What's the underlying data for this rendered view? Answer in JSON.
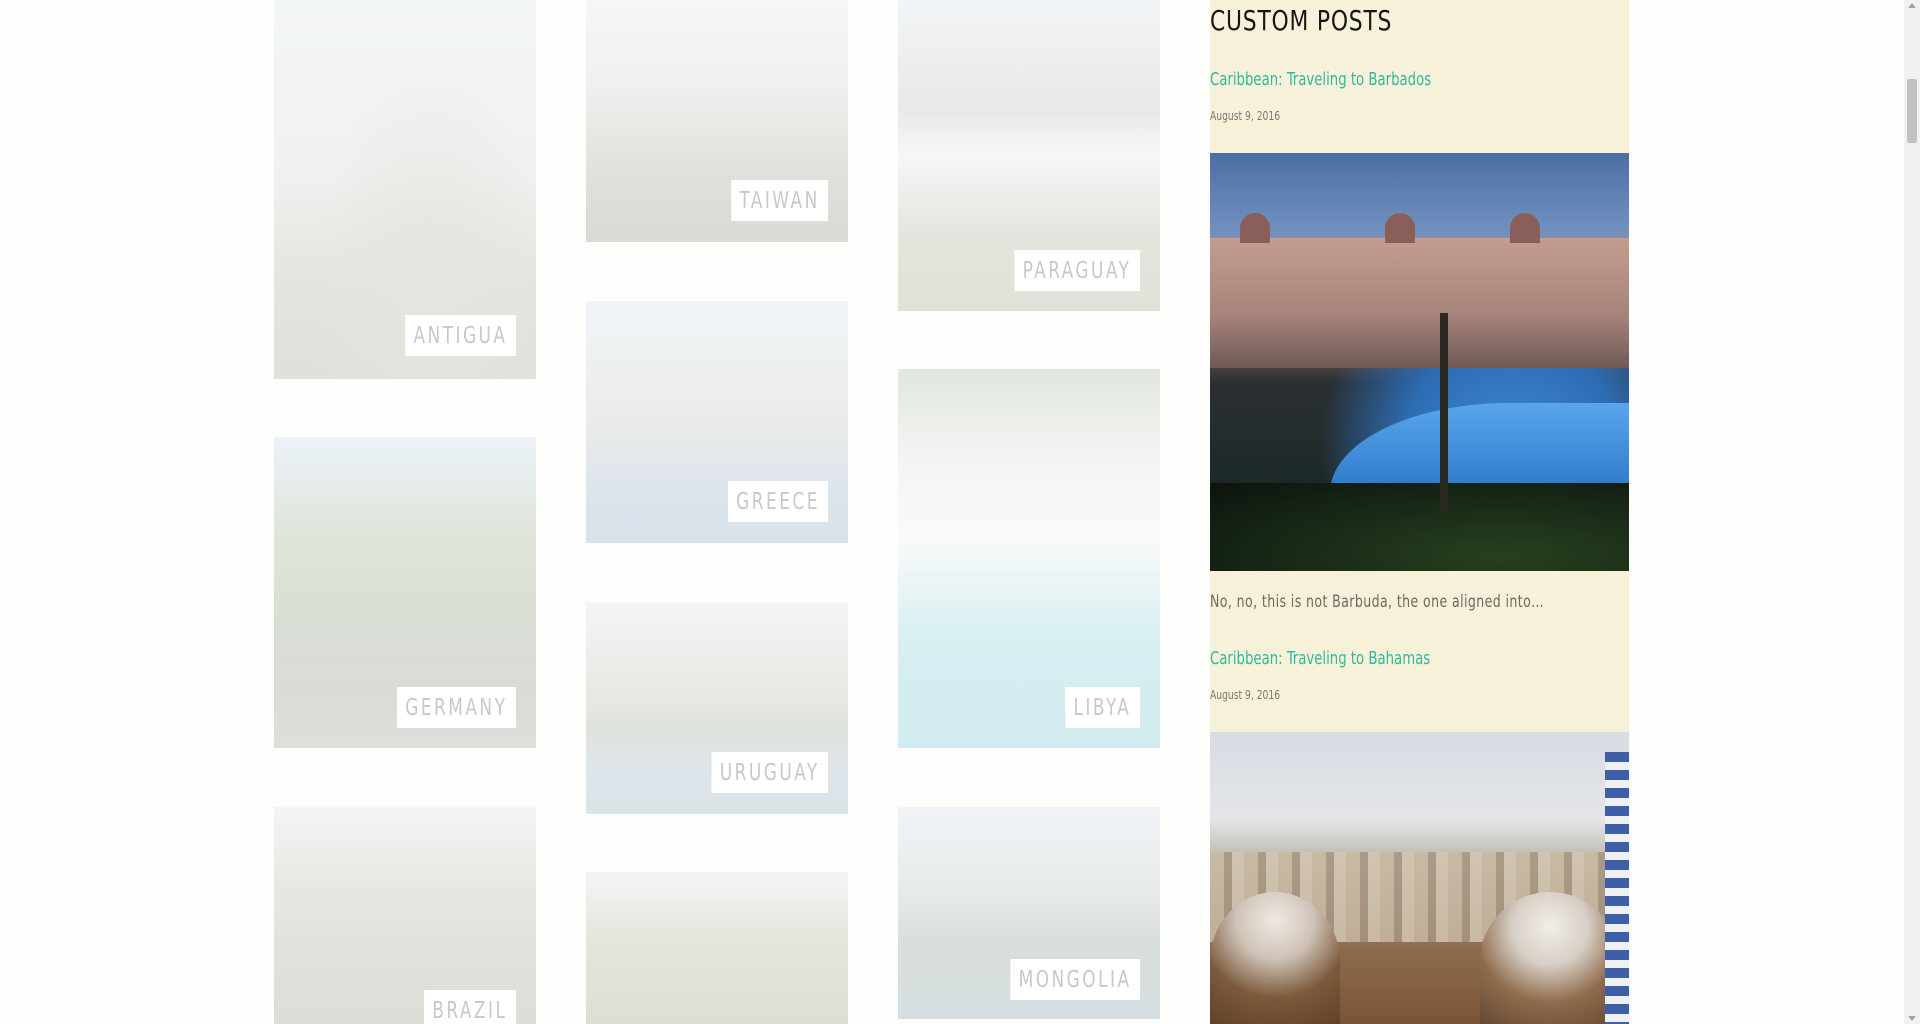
{
  "grid": {
    "tiles": [
      {
        "id": "antigua",
        "label": "ANTIGUA"
      },
      {
        "id": "germany",
        "label": "GERMANY"
      },
      {
        "id": "brazil",
        "label": "BRAZIL"
      },
      {
        "id": "taiwan",
        "label": "TAIWAN"
      },
      {
        "id": "greece",
        "label": "GREECE"
      },
      {
        "id": "uruguay",
        "label": "URUGUAY"
      },
      {
        "id": "paraguay",
        "label": "PARAGUAY"
      },
      {
        "id": "libya",
        "label": "LIBYA"
      },
      {
        "id": "mongolia",
        "label": "MONGOLIA"
      }
    ]
  },
  "sidebar": {
    "title": "CUSTOM POSTS",
    "posts": [
      {
        "title": "Caribbean: Traveling to Barbados",
        "date": "August 9, 2016",
        "excerpt": "No, no, this is not Barbuda, the one aligned into…"
      },
      {
        "title": "Caribbean: Traveling to Bahamas",
        "date": "August 9, 2016"
      }
    ]
  },
  "colors": {
    "widget_bg": "#f8f1d9",
    "link": "#2fb8a2",
    "tile_label_text": "#c8c8c8"
  }
}
